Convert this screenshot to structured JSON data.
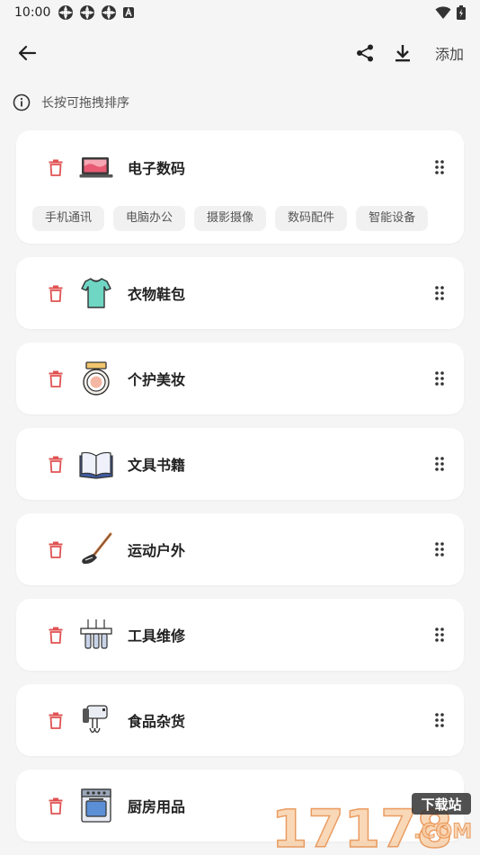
{
  "status_bar": {
    "time": "10:00"
  },
  "app_bar": {
    "add_label": "添加"
  },
  "hint": {
    "text": "长按可拖拽排序"
  },
  "categories": [
    {
      "label": "电子数码",
      "sub": [
        "手机通讯",
        "电脑办公",
        "摄影摄像",
        "数码配件",
        "智能设备"
      ]
    },
    {
      "label": "衣物鞋包"
    },
    {
      "label": "个护美妆"
    },
    {
      "label": "文具书籍"
    },
    {
      "label": "运动户外"
    },
    {
      "label": "工具维修"
    },
    {
      "label": "食品杂货"
    },
    {
      "label": "厨房用品"
    }
  ],
  "watermark": {
    "numbers": "17178",
    "tag": "下载站",
    "domain": ".COM"
  },
  "colors": {
    "trash": "#e05252",
    "chip_bg": "#f1f1f1",
    "background": "#f5f5f5"
  }
}
